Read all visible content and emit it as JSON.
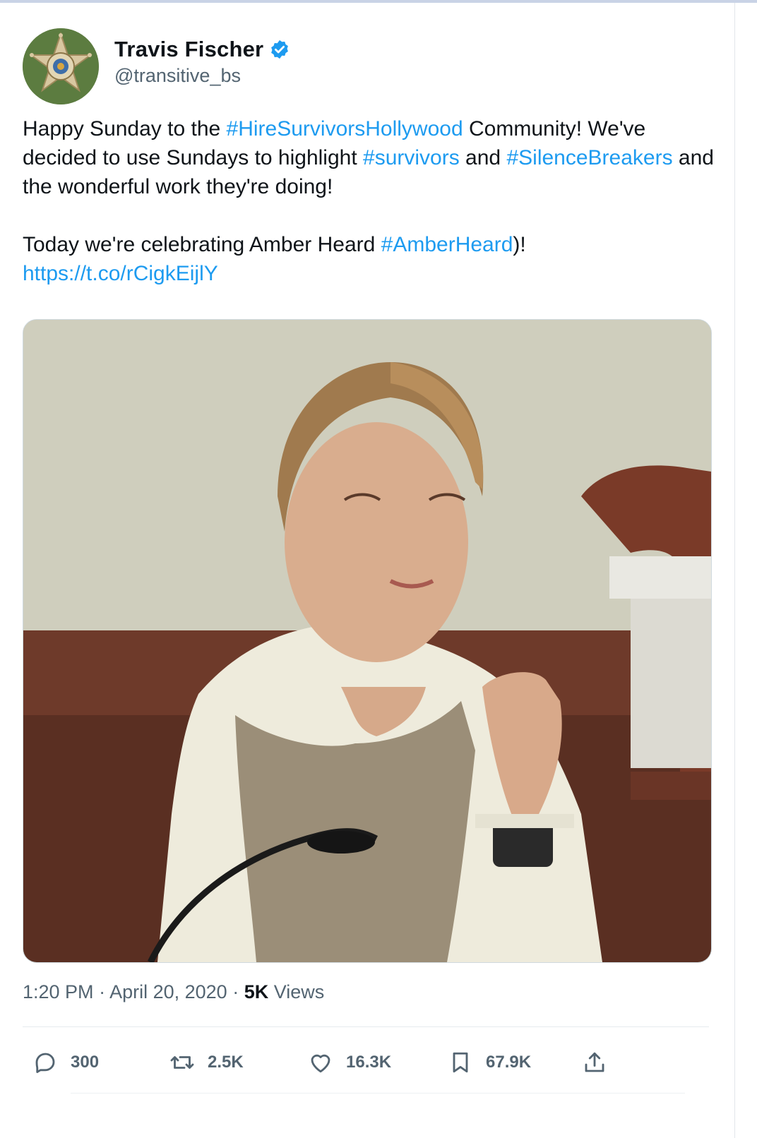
{
  "author": {
    "name": "Travis Fischer",
    "handle": "@transitive_bs",
    "avatar_icon": "sheriff-star-badge",
    "verified_icon": "verified-badge-icon"
  },
  "tweet": {
    "line1_pre": "Happy Sunday to the ",
    "line1_tag": "#HireSurvivorsHollywood",
    "line1_post": " Community! We've decided to use Sundays to highlight ",
    "tag_survivors": "#survivors",
    "and_text": " and ",
    "tag_silence": "#SilenceBreakers",
    "line1_end": " and the wonderful work they're doing!",
    "line2_pre": "Today we're celebrating Amber Heard ",
    "tag_amber": "#AmberHeard",
    "line2_post": ")!",
    "link": "https://t.co/rCigkEijlY"
  },
  "media": {
    "kind": "photo"
  },
  "meta": {
    "time": "1:20 PM",
    "sep1": " · ",
    "date": "April 20, 2020",
    "sep2": " · ",
    "views_count": "5K",
    "views_label": " Views"
  },
  "actions": {
    "reply": "300",
    "retweet": "2.5K",
    "like": "16.3K",
    "bookmark": "67.9K"
  },
  "colors": {
    "link": "#1d9bf0",
    "secondary_text": "#536471",
    "primary_text": "#0f1419"
  }
}
